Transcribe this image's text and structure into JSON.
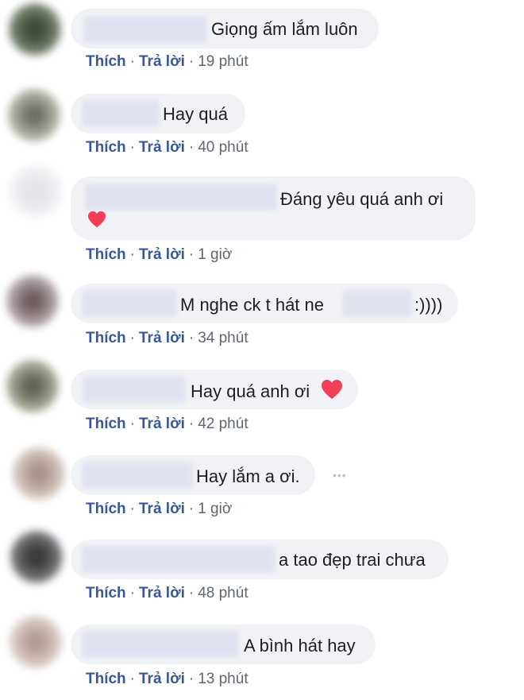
{
  "labels": {
    "like": "Thích",
    "reply": "Trả lời",
    "dot": "·"
  },
  "colors": {
    "link": "#385898",
    "bubble": "#f1f2f5",
    "meta": "#606770",
    "heart": "#f33e58"
  },
  "comments": [
    {
      "text": "Giọng ấm lắm luôn",
      "time": "19 phút"
    },
    {
      "text": "Hay quá",
      "time": "40 phút"
    },
    {
      "text": "Đáng yêu quá anh ơi",
      "time": "1 giờ",
      "emoji": "heart-icon"
    },
    {
      "text": "M nghe ck t hát ne",
      "text_after": ":))))",
      "time": "34 phút"
    },
    {
      "text": "Hay quá anh ơi",
      "time": "42 phút",
      "emoji": "heart-icon"
    },
    {
      "text": "Hay lắm a ơi.",
      "time": "1 giờ",
      "more": "•••"
    },
    {
      "text": "a tao đẹp trai chưa",
      "time": "48 phút"
    },
    {
      "text": "A bình hát hay",
      "time": "13 phút"
    }
  ]
}
